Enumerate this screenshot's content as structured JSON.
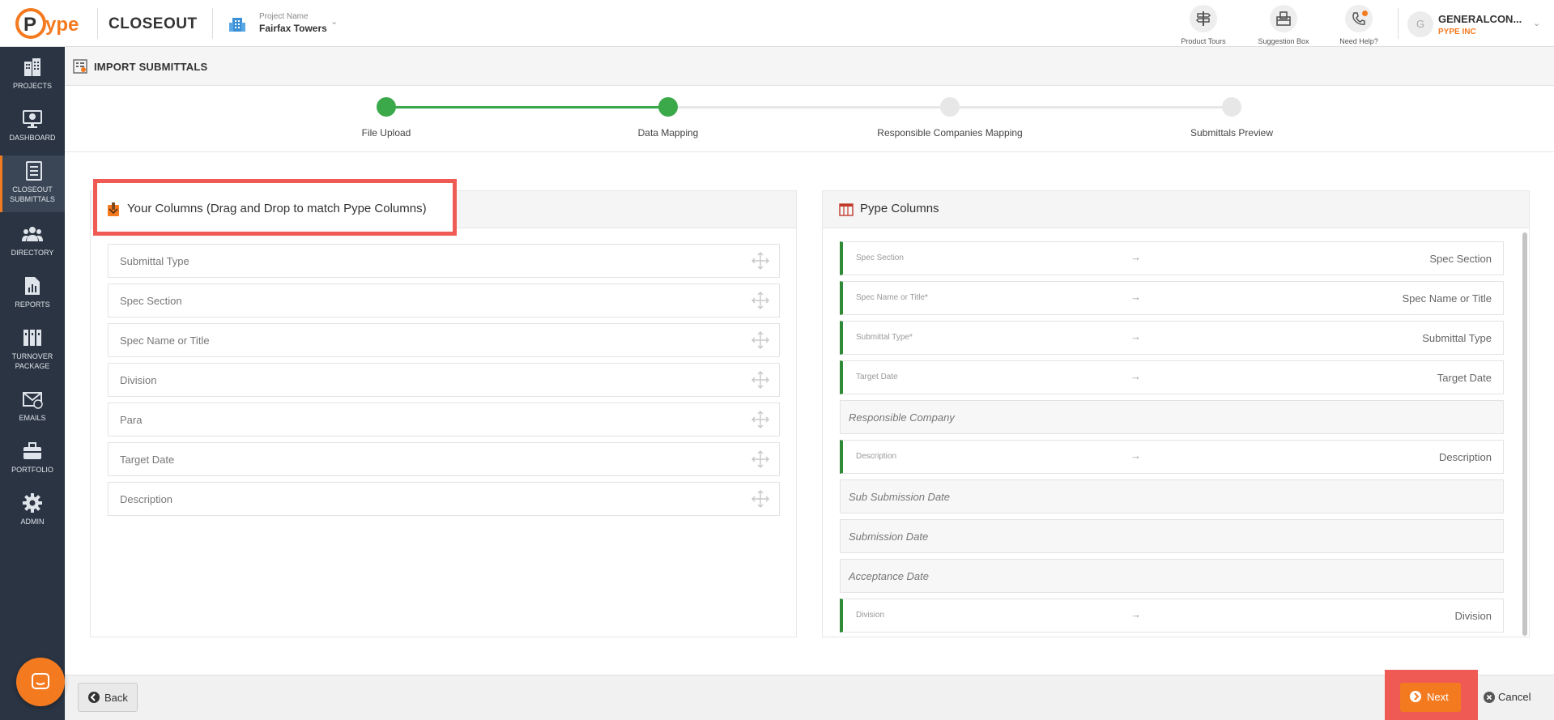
{
  "header": {
    "app_title": "CLOSEOUT",
    "project_label": "Project Name",
    "project_name": "Fairfax Towers",
    "tools": [
      {
        "label": "Product Tours",
        "icon": "signpost-icon"
      },
      {
        "label": "Suggestion Box",
        "icon": "suggestion-box-icon"
      },
      {
        "label": "Need Help?",
        "icon": "help-phone-icon"
      }
    ],
    "user_initial": "G",
    "user_name": "GENERALCON...",
    "user_company": "PYPE INC"
  },
  "sidebar": {
    "items": [
      {
        "label": "PROJECTS",
        "icon": "buildings-icon"
      },
      {
        "label": "DASHBOARD",
        "icon": "monitor-icon"
      },
      {
        "label": "CLOSEOUT SUBMITTALS",
        "icon": "document-list-icon",
        "active": true
      },
      {
        "label": "DIRECTORY",
        "icon": "people-icon"
      },
      {
        "label": "REPORTS",
        "icon": "chart-file-icon"
      },
      {
        "label": "TURNOVER PACKAGE",
        "icon": "binders-icon"
      },
      {
        "label": "EMAILS",
        "icon": "envelope-icon"
      },
      {
        "label": "PORTFOLIO",
        "icon": "briefcase-icon"
      },
      {
        "label": "ADMIN",
        "icon": "gear-icon"
      }
    ]
  },
  "page": {
    "title": "IMPORT SUBMITTALS"
  },
  "stepper": {
    "steps": [
      {
        "label": "File Upload",
        "state": "done"
      },
      {
        "label": "Data Mapping",
        "state": "done"
      },
      {
        "label": "Responsible Companies Mapping",
        "state": "todo"
      },
      {
        "label": "Submittals Preview",
        "state": "todo"
      }
    ]
  },
  "your_columns": {
    "title": "Your Columns (Drag and Drop to match Pype Columns)",
    "items": [
      "Submittal Type",
      "Spec Section",
      "Spec Name or Title",
      "Division",
      "Para",
      "Target Date",
      "Description"
    ]
  },
  "pype_columns": {
    "title": "Pype Columns",
    "rows": [
      {
        "pype": "Spec Section",
        "mapped": "Spec Section"
      },
      {
        "pype": "Spec Name or Title*",
        "mapped": "Spec Name or Title"
      },
      {
        "pype": "Submittal Type*",
        "mapped": "Submittal Type"
      },
      {
        "pype": "Target Date",
        "mapped": "Target Date"
      },
      {
        "pype": "Responsible Company",
        "mapped": null
      },
      {
        "pype": "Description",
        "mapped": "Description"
      },
      {
        "pype": "Sub Submission Date",
        "mapped": null
      },
      {
        "pype": "Submission Date",
        "mapped": null
      },
      {
        "pype": "Acceptance Date",
        "mapped": null
      },
      {
        "pype": "Division",
        "mapped": "Division"
      }
    ]
  },
  "footer": {
    "back_label": "Back",
    "next_label": "Next",
    "cancel_label": "Cancel"
  },
  "colors": {
    "accent": "#f47a20",
    "success": "#3ba94a",
    "mapped_border": "#2f8a38",
    "highlight": "#ef5a54",
    "sidebar_bg": "#2a3442"
  }
}
